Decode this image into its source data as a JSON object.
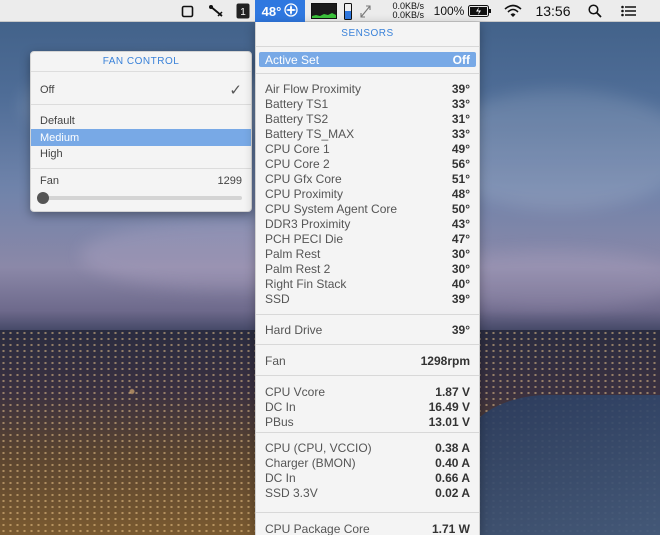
{
  "menubar": {
    "temperature": "48°",
    "net_up": "0.0KB/s",
    "net_down": "0.0KB/s",
    "battery_percent": "100%",
    "clock": "13:56",
    "icons": [
      "window-icon",
      "tools-icon",
      "one-icon",
      "fan-icon",
      "cpu-graph-icon",
      "memory-icon",
      "arrows-icon",
      "battery-icon",
      "wifi-icon",
      "search-icon",
      "list-icon"
    ]
  },
  "fan_control": {
    "title": "FAN CONTROL",
    "off_label": "Off",
    "checkmark": "✓",
    "options": [
      "Default",
      "Medium",
      "High"
    ],
    "selected": "Medium",
    "fan_label": "Fan",
    "fan_value": "1299",
    "slider_level": 0
  },
  "sensors": {
    "title": "SENSORS",
    "active_set": {
      "label": "Active Set",
      "value": "Off"
    },
    "temperatures": [
      {
        "label": "Air Flow Proximity",
        "value": "39°"
      },
      {
        "label": "Battery TS1",
        "value": "33°"
      },
      {
        "label": "Battery TS2",
        "value": "31°"
      },
      {
        "label": "Battery TS_MAX",
        "value": "33°"
      },
      {
        "label": "CPU Core 1",
        "value": "49°"
      },
      {
        "label": "CPU Core 2",
        "value": "56°"
      },
      {
        "label": "CPU Gfx Core",
        "value": "51°"
      },
      {
        "label": "CPU Proximity",
        "value": "48°"
      },
      {
        "label": "CPU System Agent Core",
        "value": "50°"
      },
      {
        "label": "DDR3 Proximity",
        "value": "43°"
      },
      {
        "label": "PCH PECI Die",
        "value": "47°"
      },
      {
        "label": "Palm Rest",
        "value": "30°"
      },
      {
        "label": "Palm Rest 2",
        "value": "30°"
      },
      {
        "label": "Right Fin Stack",
        "value": "40°"
      },
      {
        "label": "SSD",
        "value": "39°"
      }
    ],
    "drive": [
      {
        "label": "Hard Drive",
        "value": "39°"
      }
    ],
    "fan": [
      {
        "label": "Fan",
        "value": "1298rpm"
      }
    ],
    "voltages": [
      {
        "label": "CPU Vcore",
        "value": "1.87 V"
      },
      {
        "label": "DC In",
        "value": "16.49 V"
      },
      {
        "label": "PBus",
        "value": "13.01 V"
      }
    ],
    "currents": [
      {
        "label": "CPU (CPU, VCCIO)",
        "value": "0.38 A"
      },
      {
        "label": "Charger (BMON)",
        "value": "0.40 A"
      },
      {
        "label": "DC In",
        "value": "0.66 A"
      },
      {
        "label": "SSD 3.3V",
        "value": "0.02 A"
      }
    ],
    "power": [
      {
        "label": "CPU Package Core",
        "value": "1.71 W"
      }
    ]
  }
}
